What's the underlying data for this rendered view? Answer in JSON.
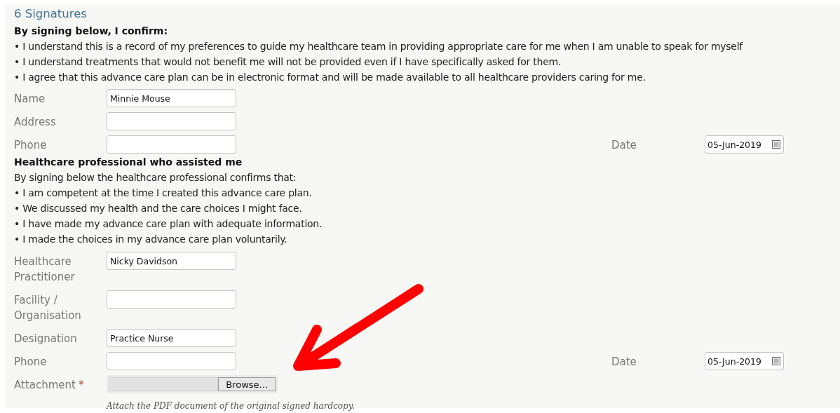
{
  "section_title": "6 Signatures",
  "patient": {
    "heading": "By signing below, I confirm:",
    "bullets": [
      "• I understand this is a record of my preferences to guide my healthcare team in providing appropriate care for me when I am unable to speak for myself",
      "• I understand treatments that would not benefit me will not be provided even if I have specifically asked for them.",
      "• I agree that this advance care plan can be in electronic format and will be made available to all healthcare providers caring for me."
    ],
    "fields": [
      {
        "label": "Name",
        "value": "Minnie Mouse"
      },
      {
        "label": "Address"
      },
      {
        "label": "Phone",
        "date_label": "Date",
        "date_value": "05-Jun-2019"
      }
    ]
  },
  "professional": {
    "heading": "Healthcare professional who assisted me",
    "intro": "By signing below the healthcare professional confirms that:",
    "bullets": [
      "• I am competent at the time I created this advance care plan.",
      "• We discussed my health and the care choices I might face.",
      "• I have made my advance care plan with adequate information.",
      "• I made the choices in my advance care plan voluntarily."
    ],
    "fields": [
      {
        "label": "Healthcare Practitioner",
        "value": "Nicky Davidson"
      },
      {
        "label": "Facility / Organisation"
      },
      {
        "label": "Designation",
        "value": "Practice Nurse"
      },
      {
        "label": "Phone",
        "date_label": "Date",
        "date_value": "05-Jun-2019"
      }
    ]
  },
  "attachment": {
    "label": "Attachment",
    "required": true,
    "required_mark": "*",
    "button": "Browse...",
    "hint": "Attach the PDF document of the original signed hardcopy."
  }
}
